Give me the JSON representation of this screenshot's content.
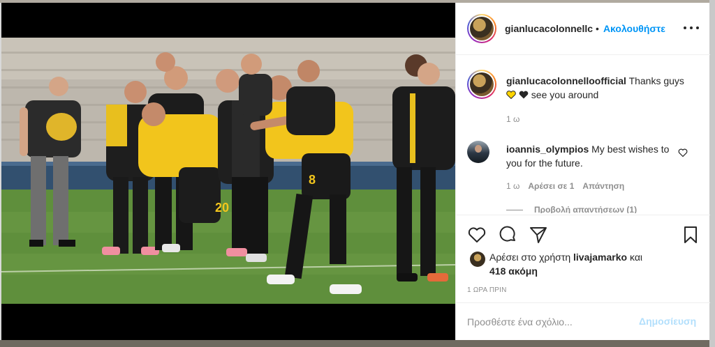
{
  "post": {
    "author": "gianlucacolonnelloofficial",
    "author_truncated": "gianlucacolonnellc",
    "separator": "•",
    "follow_label": "Ακολουθήστε",
    "more_icon": "more-horizontal-icon",
    "caption_user": "gianlucacolonnelloofficial",
    "caption_text_a": "Thanks guys",
    "caption_text_b": "see you around",
    "caption_time": "1 ω"
  },
  "comment": {
    "user": "ioannis_olympios",
    "text": "My best wishes to you for the future.",
    "time": "1 ω",
    "likes": "Αρέσει σε 1",
    "reply": "Απάντηση",
    "view_replies": "Προβολή απαντήσεων (1)"
  },
  "actions": {
    "like_icon": "heart-icon",
    "comment_icon": "comment-icon",
    "share_icon": "send-icon",
    "save_icon": "bookmark-icon"
  },
  "likes": {
    "prefix": "Αρέσει στο χρήστη",
    "user": "livajamarko",
    "conj": "και",
    "others": "418 ακόμη"
  },
  "post_time": "1 ΩΡΑ ΠΡΙΝ",
  "input": {
    "placeholder": "Προσθέστε ένα σχόλιο...",
    "value": ""
  },
  "publish_label": "Δημοσίευση",
  "colors": {
    "accent": "#0095f6",
    "accent_disabled": "#b2dffc",
    "text": "#262626",
    "muted": "#8e8e8e",
    "jersey_yellow": "#f2c51c",
    "heart_yellow": "#ffd400",
    "heart_black": "#262626"
  }
}
